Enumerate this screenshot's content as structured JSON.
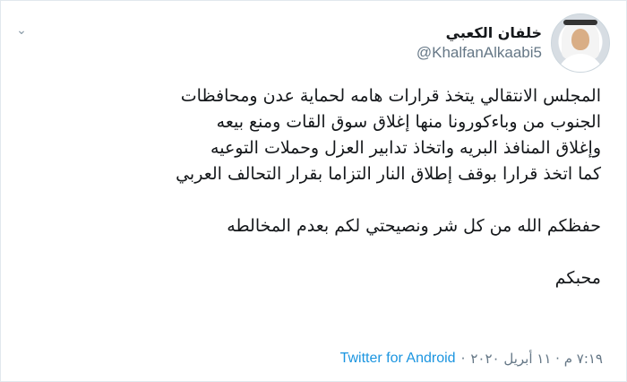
{
  "tweet": {
    "author": {
      "display_name": "خلفان الكعبي",
      "handle": "@KhalfanAlkaabi5"
    },
    "lines": [
      "المجلس الانتقالي يتخذ قرارات هامه لحماية عدن ومحافظات",
      "الجنوب من وباءكورونا منها إغلاق سوق القات ومنع بيعه",
      "وإغلاق المنافذ البريه واتخاذ تدابير العزل وحملات التوعيه",
      "كما اتخذ قرارا بوقف إطلاق النار التزاما بقرار التحالف العربي",
      "",
      "حفظكم الله من كل شر  ونصيحتي لكم بعدم المخالطه",
      "",
      "محبكم"
    ],
    "timestamp": "٧:١٩ م · ١١ أبريل ٢٠٢٠",
    "separator": "·",
    "source": "Twitter for Android"
  },
  "icons": {
    "more": "chevron-down-icon"
  }
}
